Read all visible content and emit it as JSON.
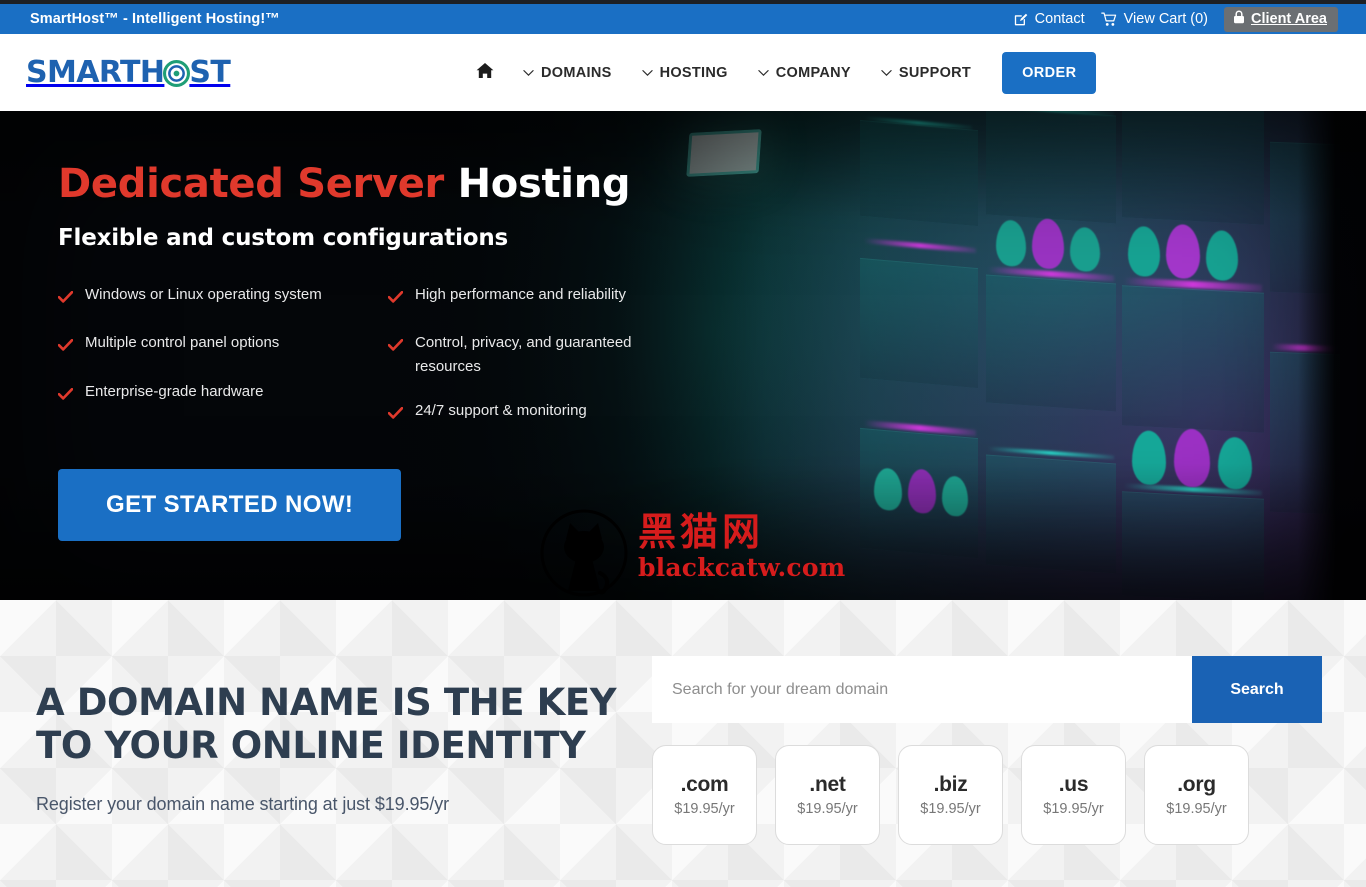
{
  "topbar": {
    "title": "SmartHost™ - Intelligent Hosting!™",
    "contact_label": "Contact",
    "cart_label": "View Cart (0)",
    "client_area_label": "Client Area",
    "bg_color": "#1a6fc4"
  },
  "header": {
    "logo_part1": "SMARTH",
    "logo_part2": "ST",
    "logo_color": "#1e62b0",
    "logo_ring_color": "#1f9e76",
    "nav": [
      {
        "label": "",
        "icon": "home-icon",
        "has_caret": false
      },
      {
        "label": "DOMAINS",
        "icon": "chevron-down-icon",
        "has_caret": true
      },
      {
        "label": "HOSTING",
        "icon": "chevron-down-icon",
        "has_caret": true
      },
      {
        "label": "COMPANY",
        "icon": "chevron-down-icon",
        "has_caret": true
      },
      {
        "label": "SUPPORT",
        "icon": "chevron-down-icon",
        "has_caret": true
      }
    ],
    "order_label": "ORDER",
    "order_color": "#1a6fc4"
  },
  "hero": {
    "title_accent": "Dedicated Server",
    "title_rest": " Hosting",
    "accent_color": "#e0392c",
    "subtitle": "Flexible and custom configurations",
    "features_left": [
      "Windows or Linux operating system",
      "Multiple control panel options",
      "Enterprise-grade hardware"
    ],
    "features_right": [
      "High performance and reliability",
      "Control, privacy, and guaranteed resources",
      "24/7 support & monitoring"
    ],
    "tick_color": "#e0392c",
    "cta_label": "GET STARTED NOW!",
    "cta_color": "#1a6fc4"
  },
  "watermark": {
    "chinese": "黑猫网",
    "url": "blackcatw.com",
    "color": "#d61c1c"
  },
  "domain": {
    "heading_line1": "A DOMAIN NAME IS THE KEY",
    "heading_line2": "TO YOUR ONLINE IDENTITY",
    "subtext": "Register your domain name starting at just $19.95/yr",
    "heading_color": "#2e3e50",
    "search_placeholder": "Search for your dream domain",
    "search_value": "",
    "search_button_label": "Search",
    "search_button_color": "#1a62b4",
    "tlds": [
      {
        "name": ".com",
        "price": "$19.95/yr"
      },
      {
        "name": ".net",
        "price": "$19.95/yr"
      },
      {
        "name": ".biz",
        "price": "$19.95/yr"
      },
      {
        "name": ".us",
        "price": "$19.95/yr"
      },
      {
        "name": ".org",
        "price": "$19.95/yr"
      }
    ]
  }
}
